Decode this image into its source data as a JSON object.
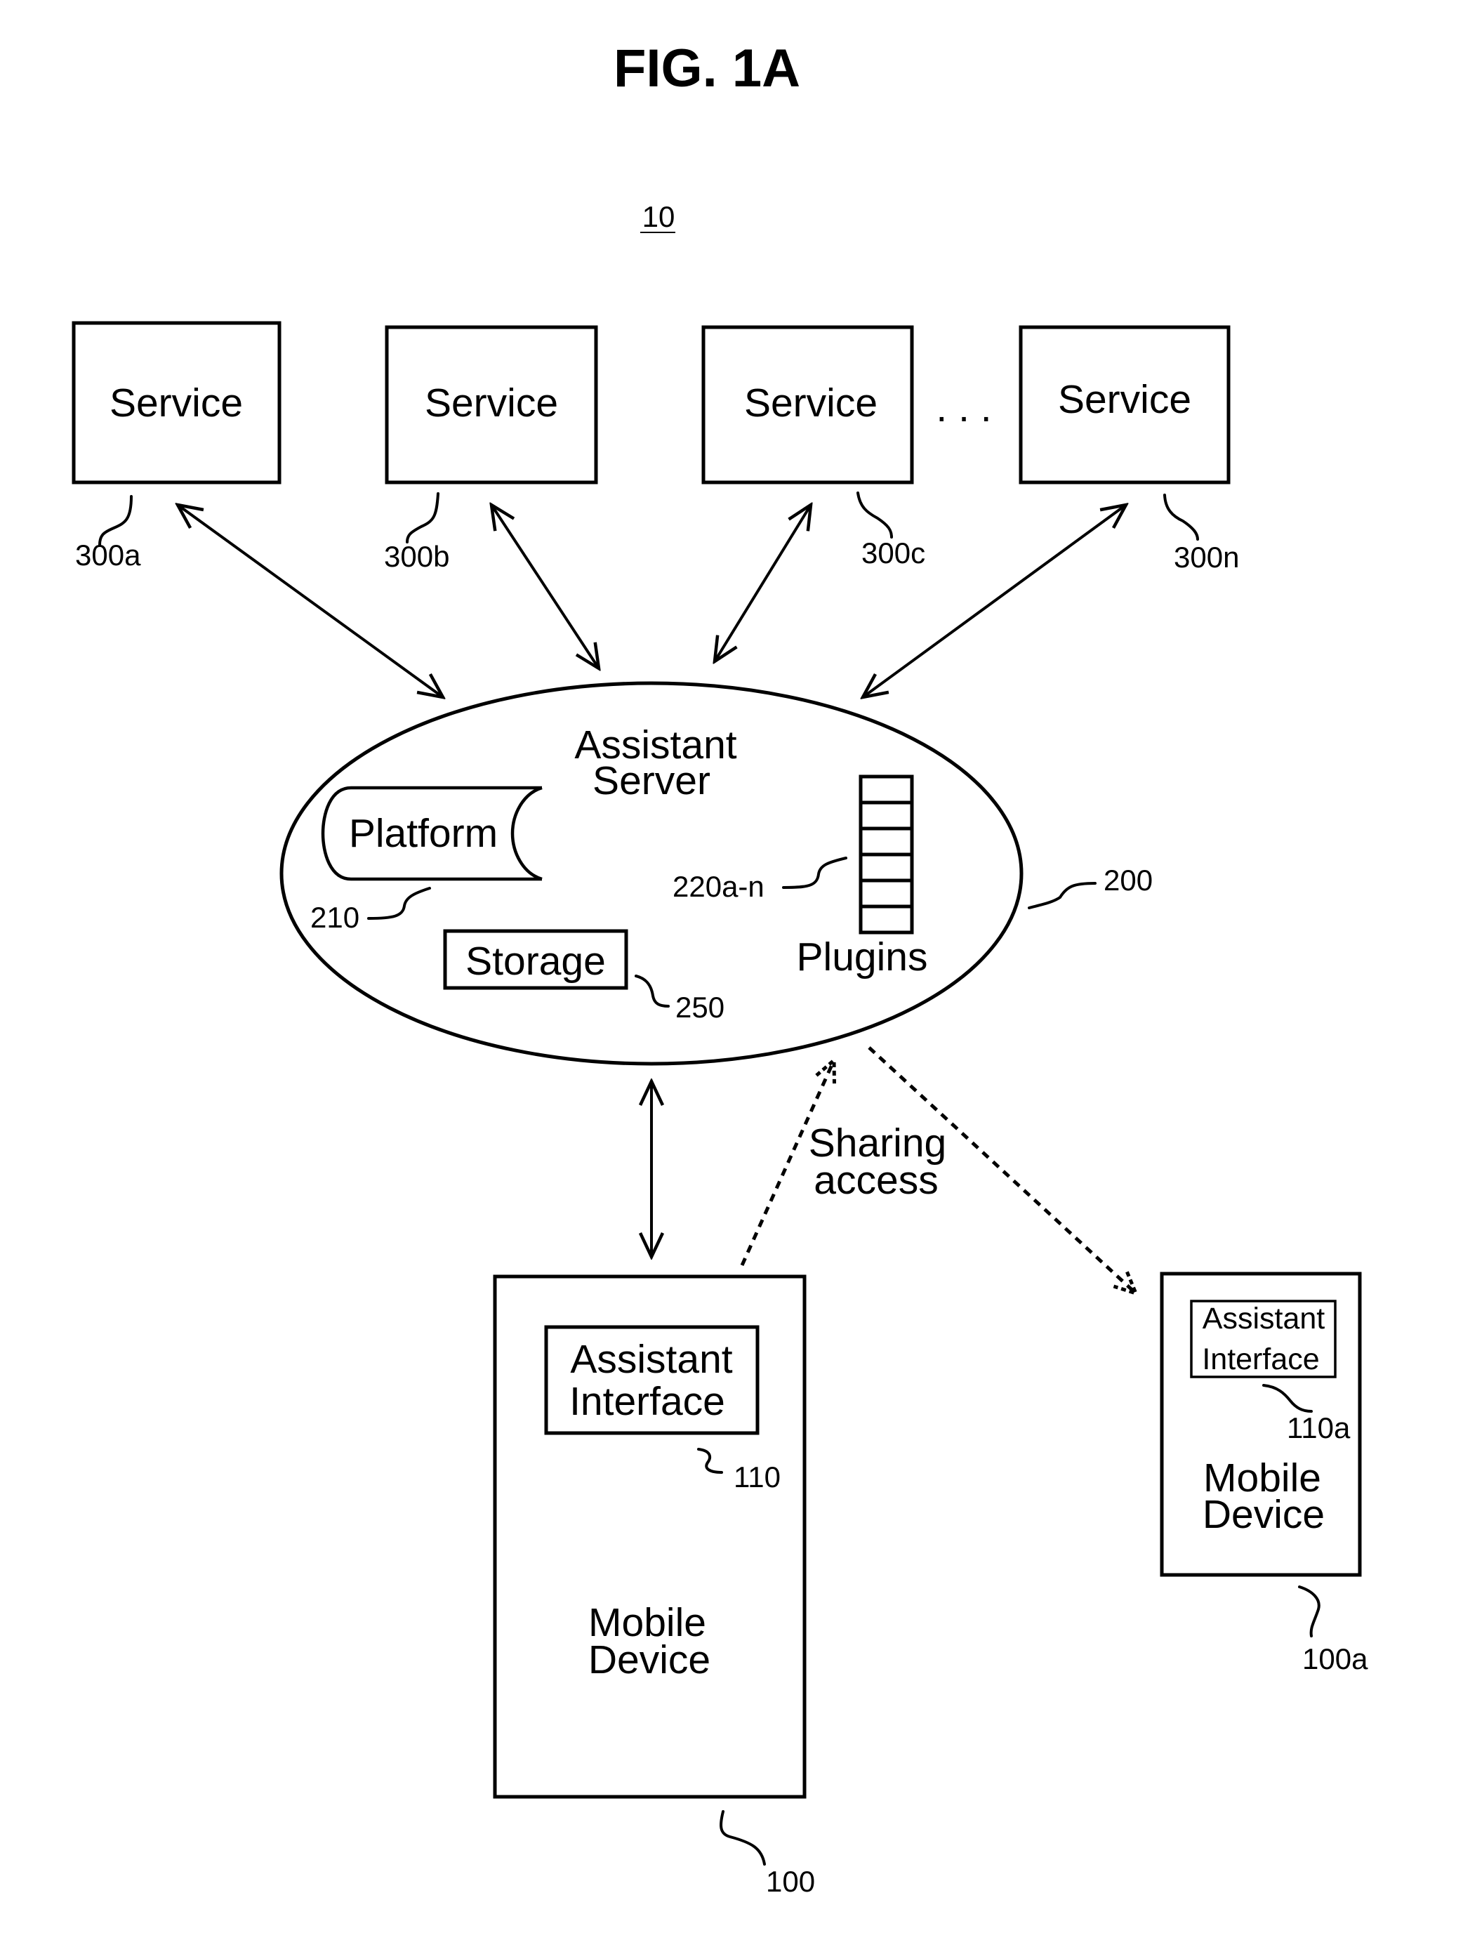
{
  "figure": {
    "title": "FIG. 1A",
    "system_ref": "10"
  },
  "services": [
    {
      "label": "Service",
      "ref": "300a"
    },
    {
      "label": "Service",
      "ref": "300b"
    },
    {
      "label": "Service",
      "ref": "300c"
    },
    {
      "label": "Service",
      "ref": "300n"
    }
  ],
  "services_ellipsis": ". . .",
  "assistant_server": {
    "title_line1": "Assistant",
    "title_line2": "Server",
    "ref": "200",
    "platform": {
      "label": "Platform",
      "ref": "210"
    },
    "plugins": {
      "label": "Plugins",
      "ref": "220a-n",
      "slot_count": 6
    },
    "storage": {
      "label": "Storage",
      "ref": "250"
    }
  },
  "sharing": {
    "line1": "Sharing",
    "line2": "access"
  },
  "mobile_device": {
    "label_line1": "Mobile",
    "label_line2": "Device",
    "ref": "100",
    "interface": {
      "line1": "Assistant",
      "line2": "Interface",
      "ref": "110"
    }
  },
  "mobile_device_a": {
    "label_line1": "Mobile",
    "label_line2": "Device",
    "ref": "100a",
    "interface": {
      "line1": "Assistant",
      "line2": "Interface",
      "ref": "110a"
    }
  }
}
